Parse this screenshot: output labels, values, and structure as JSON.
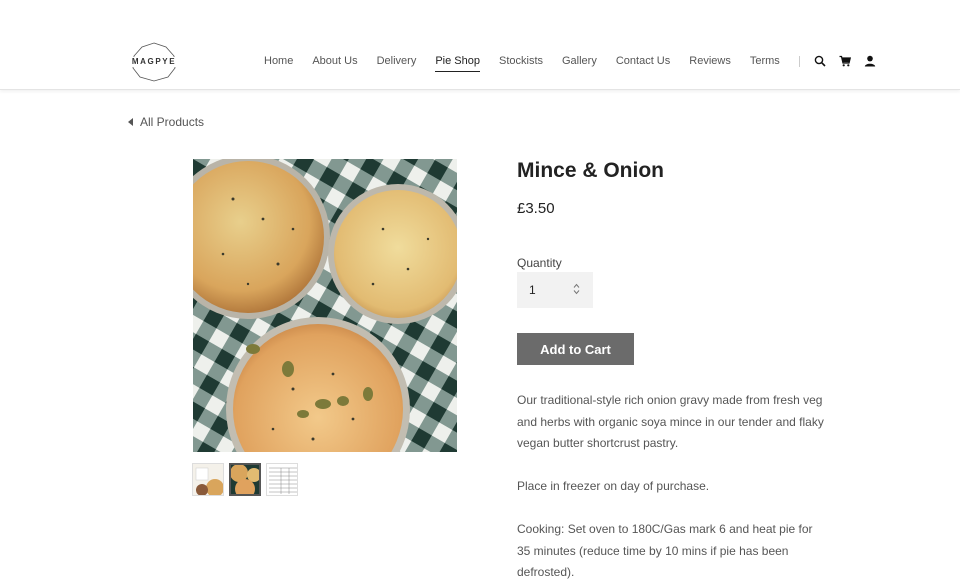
{
  "brand": {
    "logo_text": "MAGPYE"
  },
  "nav": {
    "items": [
      {
        "label": "Home"
      },
      {
        "label": "About Us"
      },
      {
        "label": "Delivery"
      },
      {
        "label": "Pie Shop",
        "active": true
      },
      {
        "label": "Stockists"
      },
      {
        "label": "Gallery"
      },
      {
        "label": "Contact Us"
      },
      {
        "label": "Reviews"
      },
      {
        "label": "Terms"
      }
    ],
    "icons": [
      "search-icon",
      "cart-icon",
      "account-icon"
    ]
  },
  "back_link": {
    "label": "All Products"
  },
  "product": {
    "title": "Mince & Onion",
    "price": "£3.50",
    "quantity_label": "Quantity",
    "quantity_value": "1",
    "add_to_cart_label": "Add to Cart",
    "description": [
      "Our traditional-style rich onion gravy made from fresh veg and herbs with organic soya mince in our tender and flaky vegan butter shortcrust pastry.",
      "Place in freezer on day of purchase.",
      "Cooking: Set oven to 180C/Gas mark 6 and heat pie for 35 minutes (reduce time by 10 mins if pie has been defrosted)."
    ],
    "thumbnail_count": 3,
    "selected_thumbnail": 2
  },
  "colors": {
    "button_bg": "#6b6b6b",
    "quantity_bg": "#f2f2f2",
    "tablecloth_dark": "#1f3a33",
    "pie_crust": "#d9a55c"
  }
}
